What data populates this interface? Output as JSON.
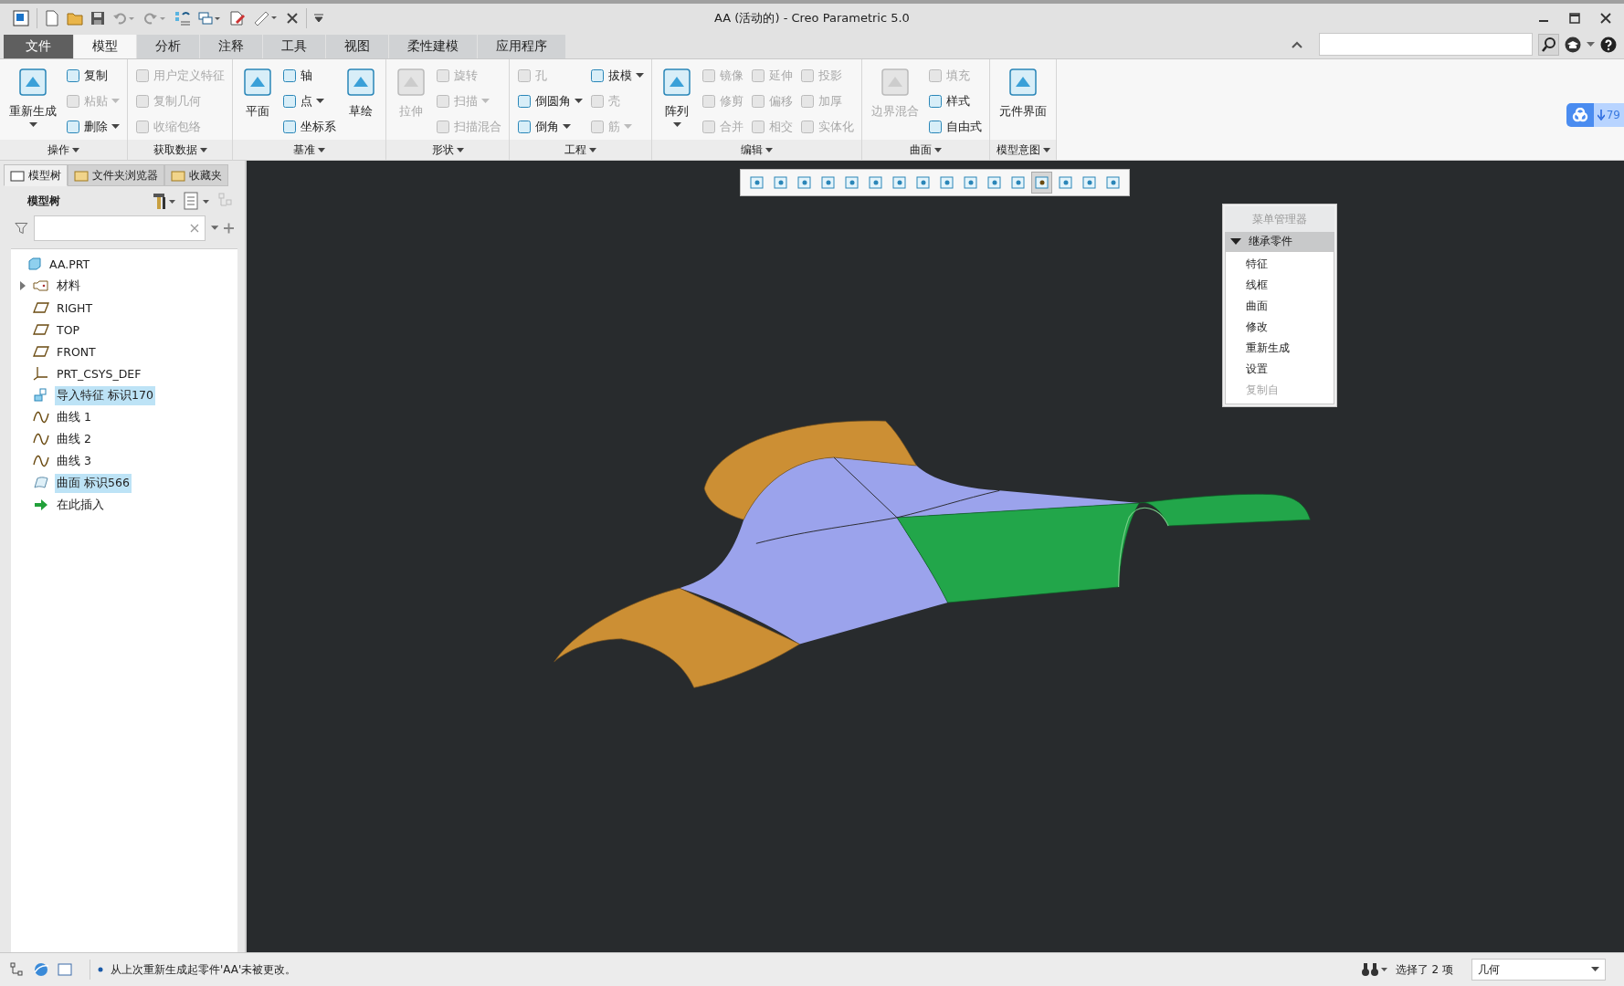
{
  "window": {
    "title": "AA (活动的) - Creo Parametric 5.0"
  },
  "ribbon_tabs": [
    {
      "label": "文件",
      "kind": "file",
      "selected": false
    },
    {
      "label": "模型",
      "kind": "tab",
      "selected": true
    },
    {
      "label": "分析",
      "kind": "tab",
      "selected": false
    },
    {
      "label": "注释",
      "kind": "tab",
      "selected": false
    },
    {
      "label": "工具",
      "kind": "tab",
      "selected": false
    },
    {
      "label": "视图",
      "kind": "tab",
      "selected": false
    },
    {
      "label": "柔性建模",
      "kind": "tab",
      "selected": false
    },
    {
      "label": "应用程序",
      "kind": "tab",
      "selected": false
    }
  ],
  "ribbon_groups": [
    {
      "label": "操作",
      "columns": [
        {
          "kind": "large",
          "items": [
            {
              "label": "重新生成",
              "disabled": false,
              "dropdown": true
            }
          ]
        },
        {
          "kind": "small",
          "items": [
            {
              "label": "复制",
              "disabled": false,
              "dropdown": false
            },
            {
              "label": "粘贴",
              "disabled": true,
              "dropdown": true
            },
            {
              "label": "删除",
              "disabled": false,
              "dropdown": true
            }
          ]
        }
      ]
    },
    {
      "label": "获取数据",
      "columns": [
        {
          "kind": "small",
          "items": [
            {
              "label": "用户定义特征",
              "disabled": true,
              "dropdown": false
            },
            {
              "label": "复制几何",
              "disabled": true,
              "dropdown": false
            },
            {
              "label": "收缩包络",
              "disabled": true,
              "dropdown": false
            }
          ]
        }
      ]
    },
    {
      "label": "基准",
      "columns": [
        {
          "kind": "large",
          "items": [
            {
              "label": "平面",
              "disabled": false,
              "dropdown": false
            }
          ]
        },
        {
          "kind": "small",
          "items": [
            {
              "label": "轴",
              "disabled": false,
              "dropdown": false
            },
            {
              "label": "点",
              "disabled": false,
              "dropdown": true
            },
            {
              "label": "坐标系",
              "disabled": false,
              "dropdown": false
            }
          ]
        },
        {
          "kind": "large",
          "items": [
            {
              "label": "草绘",
              "disabled": false,
              "dropdown": false
            }
          ]
        }
      ]
    },
    {
      "label": "形状",
      "columns": [
        {
          "kind": "large",
          "items": [
            {
              "label": "拉伸",
              "disabled": true,
              "dropdown": false
            }
          ]
        },
        {
          "kind": "small",
          "items": [
            {
              "label": "旋转",
              "disabled": true,
              "dropdown": false
            },
            {
              "label": "扫描",
              "disabled": true,
              "dropdown": true
            },
            {
              "label": "扫描混合",
              "disabled": true,
              "dropdown": false
            }
          ]
        }
      ]
    },
    {
      "label": "工程",
      "columns": [
        {
          "kind": "small",
          "items": [
            {
              "label": "孔",
              "disabled": true,
              "dropdown": false
            },
            {
              "label": "倒圆角",
              "disabled": false,
              "dropdown": true
            },
            {
              "label": "倒角",
              "disabled": false,
              "dropdown": true
            }
          ]
        },
        {
          "kind": "small",
          "items": [
            {
              "label": "拔模",
              "disabled": false,
              "dropdown": true
            },
            {
              "label": "壳",
              "disabled": true,
              "dropdown": false
            },
            {
              "label": "筋",
              "disabled": true,
              "dropdown": true
            }
          ]
        }
      ]
    },
    {
      "label": "编辑",
      "columns": [
        {
          "kind": "large",
          "items": [
            {
              "label": "阵列",
              "disabled": false,
              "dropdown": true
            }
          ]
        },
        {
          "kind": "small",
          "items": [
            {
              "label": "镜像",
              "disabled": true,
              "dropdown": false
            },
            {
              "label": "修剪",
              "disabled": true,
              "dropdown": false
            },
            {
              "label": "合并",
              "disabled": true,
              "dropdown": false
            }
          ]
        },
        {
          "kind": "small",
          "items": [
            {
              "label": "延伸",
              "disabled": true,
              "dropdown": false
            },
            {
              "label": "偏移",
              "disabled": true,
              "dropdown": false
            },
            {
              "label": "相交",
              "disabled": true,
              "dropdown": false
            }
          ]
        },
        {
          "kind": "small",
          "items": [
            {
              "label": "投影",
              "disabled": true,
              "dropdown": false
            },
            {
              "label": "加厚",
              "disabled": true,
              "dropdown": false
            },
            {
              "label": "实体化",
              "disabled": true,
              "dropdown": false
            }
          ]
        }
      ]
    },
    {
      "label": "曲面",
      "columns": [
        {
          "kind": "large",
          "items": [
            {
              "label": "边界混合",
              "disabled": true,
              "dropdown": false
            }
          ]
        },
        {
          "kind": "small",
          "items": [
            {
              "label": "填充",
              "disabled": true,
              "dropdown": false
            },
            {
              "label": "样式",
              "disabled": false,
              "dropdown": false
            },
            {
              "label": "自由式",
              "disabled": false,
              "dropdown": false
            }
          ]
        }
      ]
    },
    {
      "label": "模型意图",
      "columns": [
        {
          "kind": "large",
          "items": [
            {
              "label": "元件界面",
              "disabled": false,
              "dropdown": false
            }
          ]
        }
      ]
    }
  ],
  "download_badge": {
    "count": "79"
  },
  "panel_tabs": [
    {
      "label": "模型树",
      "selected": true
    },
    {
      "label": "文件夹浏览器",
      "selected": false
    },
    {
      "label": "收藏夹",
      "selected": false
    }
  ],
  "model_tree": {
    "title": "模型树",
    "items": [
      {
        "label": "AA.PRT",
        "kind": "part",
        "selected": false,
        "children": [
          {
            "label": "材料",
            "kind": "material",
            "selected": false,
            "expanded": false
          },
          {
            "label": "RIGHT",
            "kind": "plane",
            "selected": false
          },
          {
            "label": "TOP",
            "kind": "plane",
            "selected": false
          },
          {
            "label": "FRONT",
            "kind": "plane",
            "selected": false
          },
          {
            "label": "PRT_CSYS_DEF",
            "kind": "csys",
            "selected": false
          },
          {
            "label": "导入特征 标识170",
            "kind": "import",
            "selected": true
          },
          {
            "label": "曲线 1",
            "kind": "curve",
            "selected": false
          },
          {
            "label": "曲线 2",
            "kind": "curve",
            "selected": false
          },
          {
            "label": "曲线 3",
            "kind": "curve",
            "selected": false
          },
          {
            "label": "曲面 标识566",
            "kind": "surface",
            "selected": true
          },
          {
            "label": "在此插入",
            "kind": "insert",
            "selected": false
          }
        ]
      }
    ]
  },
  "view_toolbar": [
    {
      "selected": false
    },
    {
      "selected": false
    },
    {
      "selected": false
    },
    {
      "selected": false
    },
    {
      "selected": false
    },
    {
      "selected": false
    },
    {
      "selected": false
    },
    {
      "selected": false
    },
    {
      "selected": false
    },
    {
      "selected": false
    },
    {
      "selected": false
    },
    {
      "selected": false
    },
    {
      "selected": true
    },
    {
      "selected": false
    },
    {
      "selected": false
    },
    {
      "selected": false
    }
  ],
  "menu_manager": {
    "title": "菜单管理器",
    "section": {
      "label": "继承零件",
      "expanded": true,
      "items": [
        {
          "label": "特征",
          "disabled": false
        },
        {
          "label": "线框",
          "disabled": false
        },
        {
          "label": "曲面",
          "disabled": false
        },
        {
          "label": "修改",
          "disabled": false
        },
        {
          "label": "重新生成",
          "disabled": false
        },
        {
          "label": "设置",
          "disabled": false
        },
        {
          "label": "复制自",
          "disabled": true
        }
      ]
    }
  },
  "status_bar": {
    "message": "从上次重新生成起零件'AA'未被更改。",
    "selection": "选择了 2 项",
    "filter": "几何"
  }
}
